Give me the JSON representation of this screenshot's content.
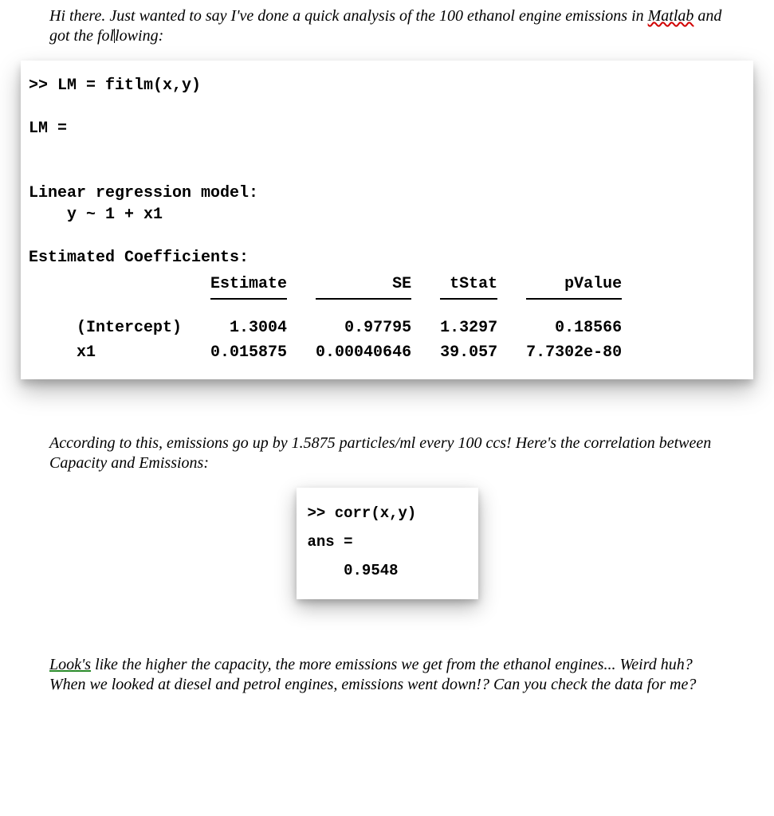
{
  "intro": {
    "pre": "Hi there. Just wanted to say I've done a quick analysis of the 100 ethanol engine emissions in ",
    "matlab": "Matlab",
    "post": " and got the fol",
    "post2": "lowing:"
  },
  "fitlm": {
    "cmd": ">> LM = fitlm(x,y)",
    "lmeq": "LM =",
    "model_h": "Linear regression model:",
    "model_eq": "    y ~ 1 + x1",
    "est_h": "Estimated Coefficients:",
    "headers": [
      "",
      "Estimate",
      "SE",
      "tStat",
      "pValue"
    ],
    "rows": [
      {
        "name": "(Intercept)",
        "est": "1.3004",
        "se": "0.97795",
        "t": "1.3297",
        "p": "0.18566"
      },
      {
        "name": "x1",
        "est": "0.015875",
        "se": "0.00040646",
        "t": "39.057",
        "p": "7.7302e-80"
      }
    ]
  },
  "mid": "According to this, emissions go up by 1.5875 particles/ml every 100 ccs! Here's the correlation between Capacity and Emissions:",
  "corr": {
    "cmd": ">> corr(x,y)",
    "ans": "ans =",
    "val": "    0.9548"
  },
  "outro": {
    "looks": "Look's",
    "rest": " like the higher the capacity, the more emissions we get from the ethanol engines... Weird huh? When we looked at diesel and petrol engines, emissions went down!? Can you check the data for me?"
  }
}
